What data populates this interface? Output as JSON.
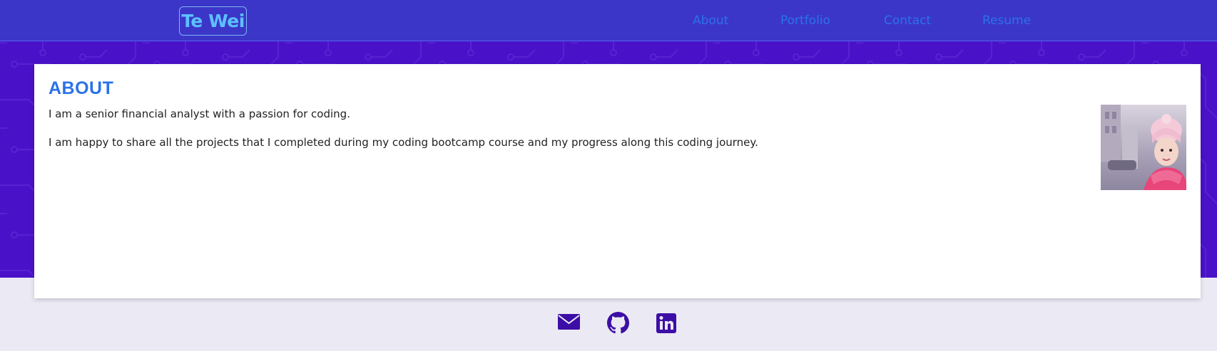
{
  "header": {
    "brand": "Te Wei",
    "nav": [
      {
        "label": "About"
      },
      {
        "label": "Portfolio"
      },
      {
        "label": "Contact"
      },
      {
        "label": "Resume"
      }
    ]
  },
  "about": {
    "title": "ABOUT",
    "paragraphs": [
      "I am a senior financial analyst with a passion for coding.",
      "I am happy to share all the projects that I completed during my coding bootcamp course and my progress along this coding journey."
    ]
  },
  "footer": {
    "icons": [
      "email-icon",
      "github-icon",
      "linkedin-icon"
    ]
  },
  "colors": {
    "nav_bg": "#3b36c8",
    "hero_bg": "#4a12c8",
    "accent": "#2a72e8",
    "brand": "#5cc0ff",
    "icon": "#3d0ea6",
    "footer_bg": "#ebeaf4"
  }
}
